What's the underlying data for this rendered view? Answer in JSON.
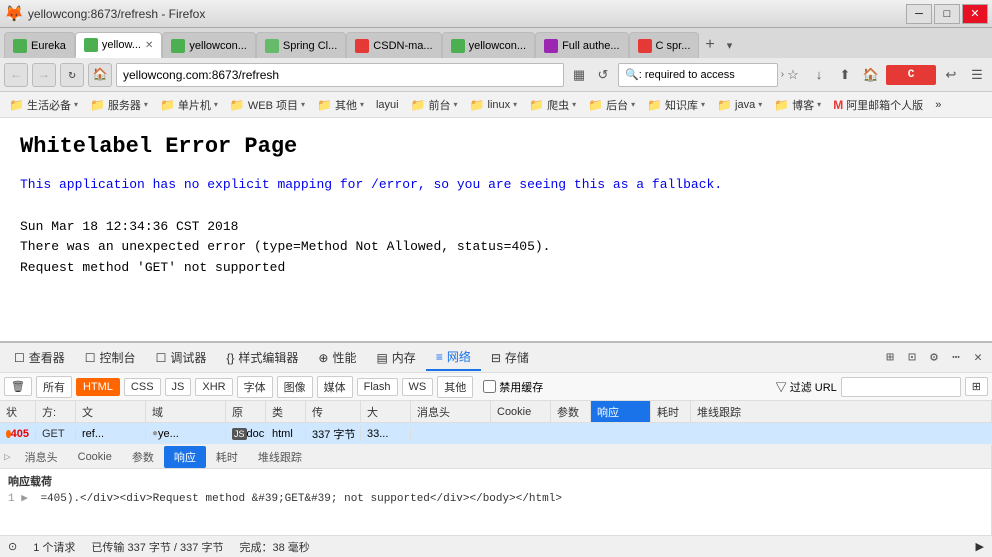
{
  "titlebar": {
    "title": "yellowcong:8673/refresh - Firefox"
  },
  "tabs": [
    {
      "id": "t1",
      "label": "Eureka",
      "color": "#4CAF50",
      "active": false
    },
    {
      "id": "t2",
      "label": "yellowc...",
      "color": "#4CAF50",
      "active": true
    },
    {
      "id": "t3",
      "label": "yellowcon...",
      "color": "#4CAF50",
      "active": false
    },
    {
      "id": "t4",
      "label": "Spring Cl...",
      "color": "#66bb6a",
      "active": false
    },
    {
      "id": "t5",
      "label": "CSDN-ma...",
      "color": "#e53935",
      "active": false
    },
    {
      "id": "t6",
      "label": "yellowcon...",
      "color": "#4CAF50",
      "active": false
    },
    {
      "id": "t7",
      "label": "Full authe...",
      "color": "#9c27b0",
      "active": false
    },
    {
      "id": "t8",
      "label": "C spr...",
      "color": "#e53935",
      "active": false
    }
  ],
  "addressbar": {
    "url": "yellowcong.com:8673/refresh",
    "search_query": ": required to access",
    "search_placeholder": ": required to access"
  },
  "bookmarks": [
    "生活必备",
    "服务器",
    "单片机",
    "WEB 项目",
    "其他",
    "layui",
    "前台",
    "linux",
    "爬虫",
    "后台",
    "知识库",
    "java",
    "博客",
    "阿里邮箱个人版"
  ],
  "page": {
    "title": "Whitelabel Error Page",
    "line1": "This application has no explicit mapping for /error, so you are seeing this as a fallback.",
    "line2": "",
    "line3": "Sun Mar 18 12:34:36 CST 2018",
    "line4": "There was an unexpected error (type=Method Not Allowed, status=405).",
    "line5": "Request method 'GET' not supported"
  },
  "devtools": {
    "tabs": [
      {
        "label": "查看器",
        "icon": "☐"
      },
      {
        "label": "控制台",
        "icon": "☐"
      },
      {
        "label": "调试器",
        "icon": "☐"
      },
      {
        "label": "样式编辑器",
        "icon": "{}"
      },
      {
        "label": "性能",
        "icon": "⊕"
      },
      {
        "label": "内存",
        "icon": "▤"
      },
      {
        "label": "网络",
        "icon": "≡",
        "active": true
      },
      {
        "label": "存储",
        "icon": "⊟"
      }
    ],
    "filter_buttons": [
      "所有",
      "HTML",
      "CSS",
      "JS",
      "XHR",
      "字体",
      "图像",
      "媒体",
      "Flash",
      "WS",
      "其他"
    ],
    "active_filter": "HTML",
    "disable_cache_label": "禁用缓存",
    "url_filter_placeholder": "过滤 URL",
    "table_headers": [
      "状",
      "方:",
      "文",
      "域",
      "原",
      "类",
      "传",
      "大",
      "消息头",
      "Cookie",
      "参数",
      "响应",
      "耗时",
      "堆线跟踪"
    ],
    "table_row": {
      "status": "405",
      "method": "GET",
      "file": "ref...",
      "domain": "ye...",
      "extra": "JS doc...",
      "type": "html",
      "transfer": "337 字节",
      "size": "33..."
    },
    "response_tabs": [
      "消息头",
      "Cookie",
      "参数",
      "响应",
      "耗时",
      "堆线跟踪"
    ],
    "active_response_tab": "响应",
    "response_label": "响应载荷",
    "response_line": "=405).</div><div>Request method &#39;GET&#39; not supported</div></body></html>",
    "statusbar": {
      "requests": "1 个请求",
      "transferred": "已传输 337 字节 / 337 字节",
      "complete": "完成：38 毫秒"
    }
  }
}
